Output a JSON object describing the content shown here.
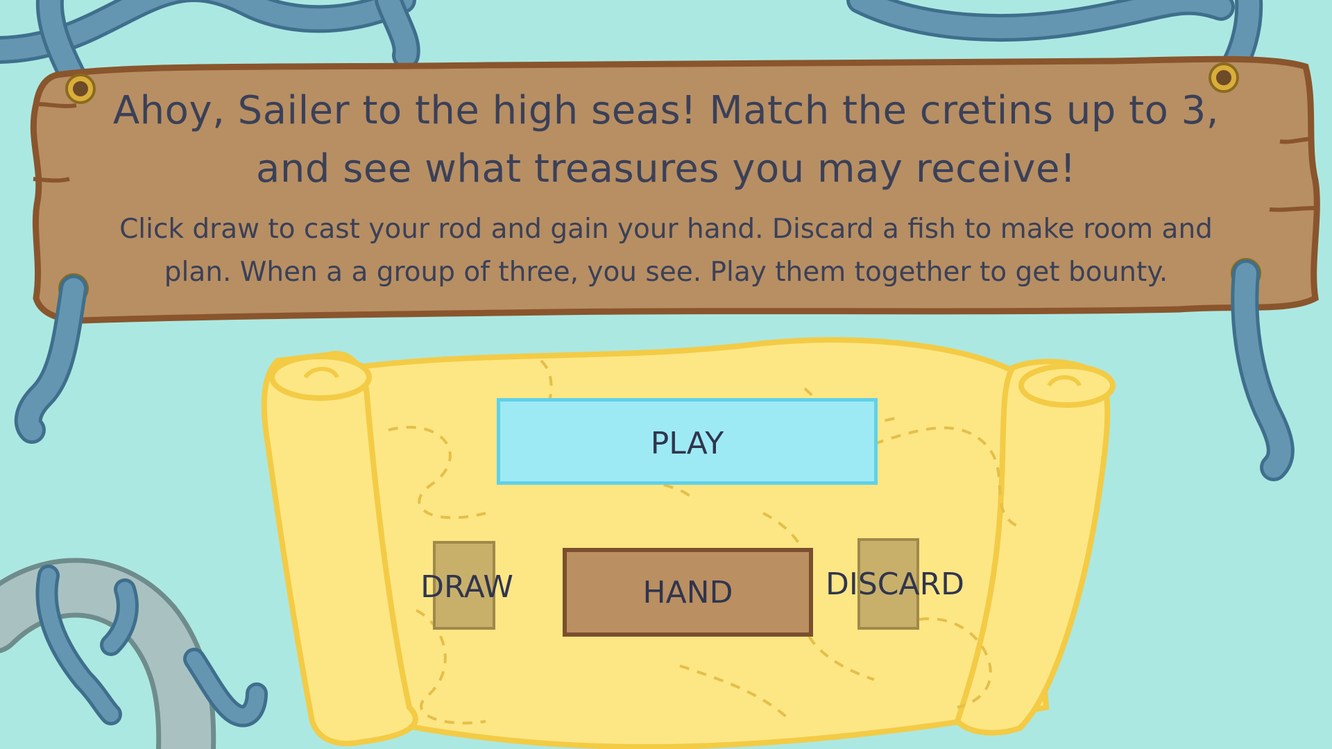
{
  "sign": {
    "headline": "Ahoy, Sailer to the high seas! Match the cretins up to 3, and see what treasures you may receive!",
    "instructions": "Click draw to cast your rod and gain your hand. Discard a fish to make room and plan. When a a group of three, you see. Play them together to get bounty."
  },
  "controls": {
    "play_label": "PLAY",
    "draw_label": "DRAW",
    "hand_label": "HAND",
    "discard_label": "DISCARD"
  },
  "colors": {
    "ocean": "#ace8e2",
    "sign_wood": "#b78f63",
    "sign_border": "#8a552c",
    "scroll": "#fde684",
    "scroll_border": "#f3cb45",
    "play_button": "#9deaf4",
    "hand_button": "#ba8f61",
    "card_pile": "#c8b06b",
    "rope": "#5f8fab",
    "text": "#3b4058"
  }
}
